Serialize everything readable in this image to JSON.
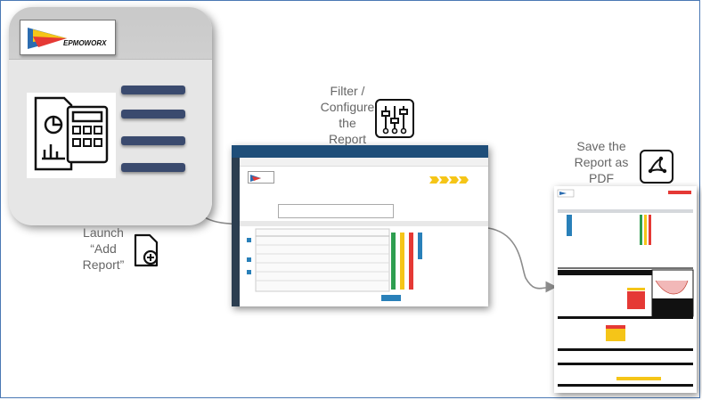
{
  "app_logo_text": "EPMOWORX",
  "steps": [
    {
      "caption": "Launch\n“Add\nReport”",
      "icon": "add-file-icon"
    },
    {
      "caption": "Filter /\nConfigure\nthe\nReport",
      "icon": "sliders-icon"
    },
    {
      "caption": "Save the\nReport as\nPDF",
      "icon": "pdf-icon"
    }
  ],
  "colors": {
    "frame_border": "#4a78b4",
    "tile_gray": "#d7d7d7",
    "menu_bar": "#3a4a6e",
    "app_header": "#1f4e79",
    "accent_yellow": "#f5c518",
    "accent_red": "#e53935",
    "accent_green": "#2e9e4f",
    "connector": "#8c8c8c"
  }
}
